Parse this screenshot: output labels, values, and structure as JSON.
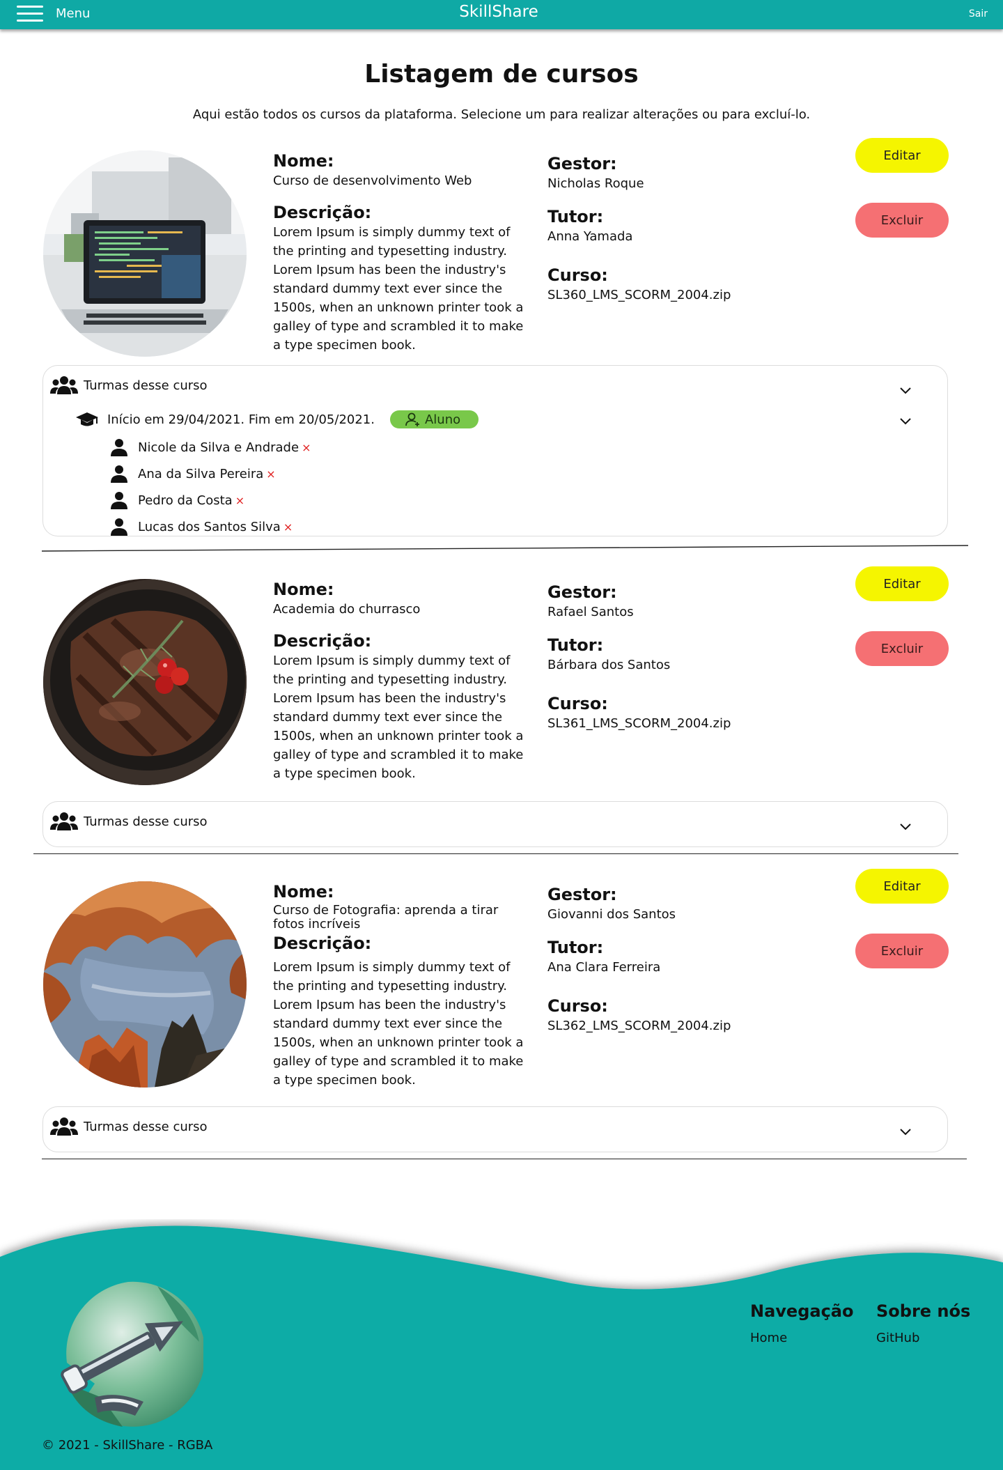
{
  "header": {
    "menu_label": "Menu",
    "brand": "SkillShare",
    "logout_label": "Sair",
    "color": "#0fa9a5"
  },
  "page": {
    "title": "Listagem de cursos",
    "subtitle": "Aqui estão todos os cursos da plataforma. Selecione um para realizar alterações ou para excluí-lo."
  },
  "labels": {
    "name": "Nome:",
    "description": "Descrição:",
    "manager": "Gestor:",
    "tutor": "Tutor:",
    "course_file": "Curso:",
    "edit": "Editar",
    "delete": "Excluir",
    "classes_toggle": "Turmas desse curso"
  },
  "courses": [
    {
      "image": "laptop-with-code",
      "name": "Curso de desenvolvimento Web",
      "description": "Lorem Ipsum is simply dummy text of the printing and typesetting industry. Lorem Ipsum has been the industry's standard dummy text ever since the 1500s, when an unknown printer took a galley of type and scrambled it to make a type specimen book.",
      "manager": "Nicholas Roque",
      "tutor": "Anna Yamada",
      "file": "SL360_LMS_SCORM_2004.zip",
      "expanded": true,
      "classes": [
        {
          "period": "Início em 29/04/2021. Fim em 20/05/2021.",
          "badge": "Aluno",
          "students": [
            "Nicole da Silva e Andrade",
            "Ana da Silva Pereira",
            "Pedro da Costa",
            "Lucas dos Santos Silva"
          ],
          "remove_symbol": "×"
        }
      ]
    },
    {
      "image": "grilled-steak",
      "name": "Academia do churrasco",
      "description": "Lorem Ipsum is simply dummy text of the printing and typesetting industry. Lorem Ipsum has been the industry's standard dummy text ever since the 1500s, when an unknown printer took a galley of type and scrambled it to make a type specimen book.",
      "manager": "Rafael Santos",
      "tutor": "Bárbara dos Santos",
      "file": "SL361_LMS_SCORM_2004.zip",
      "expanded": false
    },
    {
      "image": "canyon-sky",
      "name": "Curso de Fotografia: aprenda a tirar fotos incríveis",
      "description": "Lorem Ipsum is simply dummy text of the printing and typesetting industry. Lorem Ipsum has been the industry's standard dummy text ever since the 1500s, when an unknown printer took a galley of type and scrambled it to make a type specimen book.",
      "manager": "Giovanni dos Santos",
      "tutor": "Ana Clara Ferreira",
      "file": "SL362_LMS_SCORM_2004.zip",
      "expanded": false
    }
  ],
  "footer": {
    "nav_title": "Navegação",
    "nav_link": "Home",
    "about_title": "Sobre nós",
    "about_link": "GitHub",
    "copyright": "© 2021 - SkillShare - RGBA",
    "color": "#0aaca6"
  },
  "colors": {
    "edit_button": "#f5f500",
    "delete_button": "#f57073",
    "role_badge": "#79c84a",
    "remove_x": "#e02020"
  }
}
